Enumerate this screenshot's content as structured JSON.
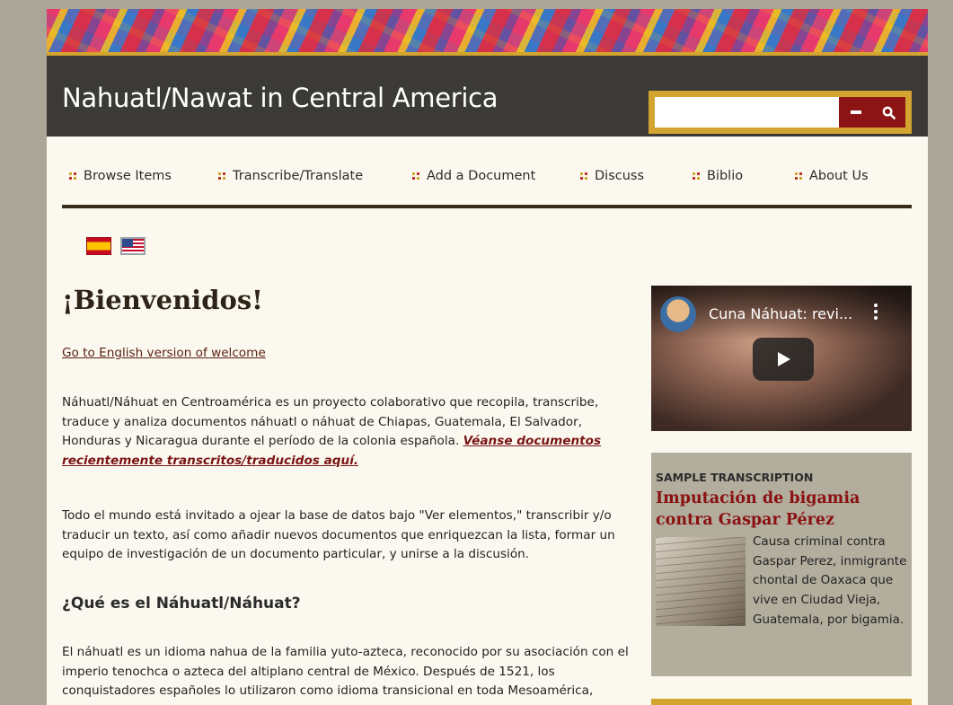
{
  "header": {
    "site_title": "Nahuatl/Nawat in Central America",
    "search": {
      "placeholder": "",
      "advanced_icon": "minus-icon",
      "submit_icon": "search-icon"
    }
  },
  "nav": {
    "items": [
      {
        "label": "Browse Items"
      },
      {
        "label": "Transcribe/Translate"
      },
      {
        "label": "Add a Document"
      },
      {
        "label": "Discuss"
      },
      {
        "label": "Biblio"
      },
      {
        "label": "About Us"
      }
    ]
  },
  "languages": [
    "spanish-flag-icon",
    "us-flag-icon"
  ],
  "main": {
    "heading": "¡Bienvenidos!",
    "english_link": "Go to English version of welcome",
    "p1_text": "Náhuatl/Náhuat en Centroamérica es un proyecto colaborativo que recopila, transcribe, traduce y analiza documentos náhuatl o náhuat de Chiapas, Guatemala, El Salvador, Honduras y Nicaragua durante el período de la colonia española.",
    "p1_link": "Véanse documentos recientemente transcritos/traducidos aquí.",
    "p2": "Todo el mundo está invitado a ojear la base de datos bajo \"Ver elementos,\" transcribir y/o traducir un texto, así como añadir nuevos documentos que enriquezcan la lista, formar un equipo de investigación de un documento particular, y unirse a la discusión.",
    "subheading": "¿Qué es el Náhuatl/Náhuat?",
    "p3": "El náhuatl es un idioma nahua de la familia yuto-azteca, reconocido por su asociación con el imperio tenochca o azteca del altiplano central de México.  Después de 1521, los conquistadores españoles lo utilizaron como idioma transicional en toda Mesoamérica,"
  },
  "sidebar": {
    "video": {
      "title": "Cuna Náhuat: revi...",
      "more_icon": "more-vertical-icon",
      "play_icon": "play-icon"
    },
    "sample": {
      "kicker": "SAMPLE TRANSCRIPTION",
      "title": "Imputación de bigamia contra Gaspar Pérez",
      "description": "Causa criminal contra Gaspar Perez, inmigrante chontal de Oaxaca que vive en Ciudad Vieja, Guatemala, por bigamia."
    }
  },
  "colors": {
    "accent": "#d4a430",
    "header": "#3b3a36",
    "button": "#8d1414",
    "page": "#fbf9ef",
    "frame": "#aaa596"
  }
}
